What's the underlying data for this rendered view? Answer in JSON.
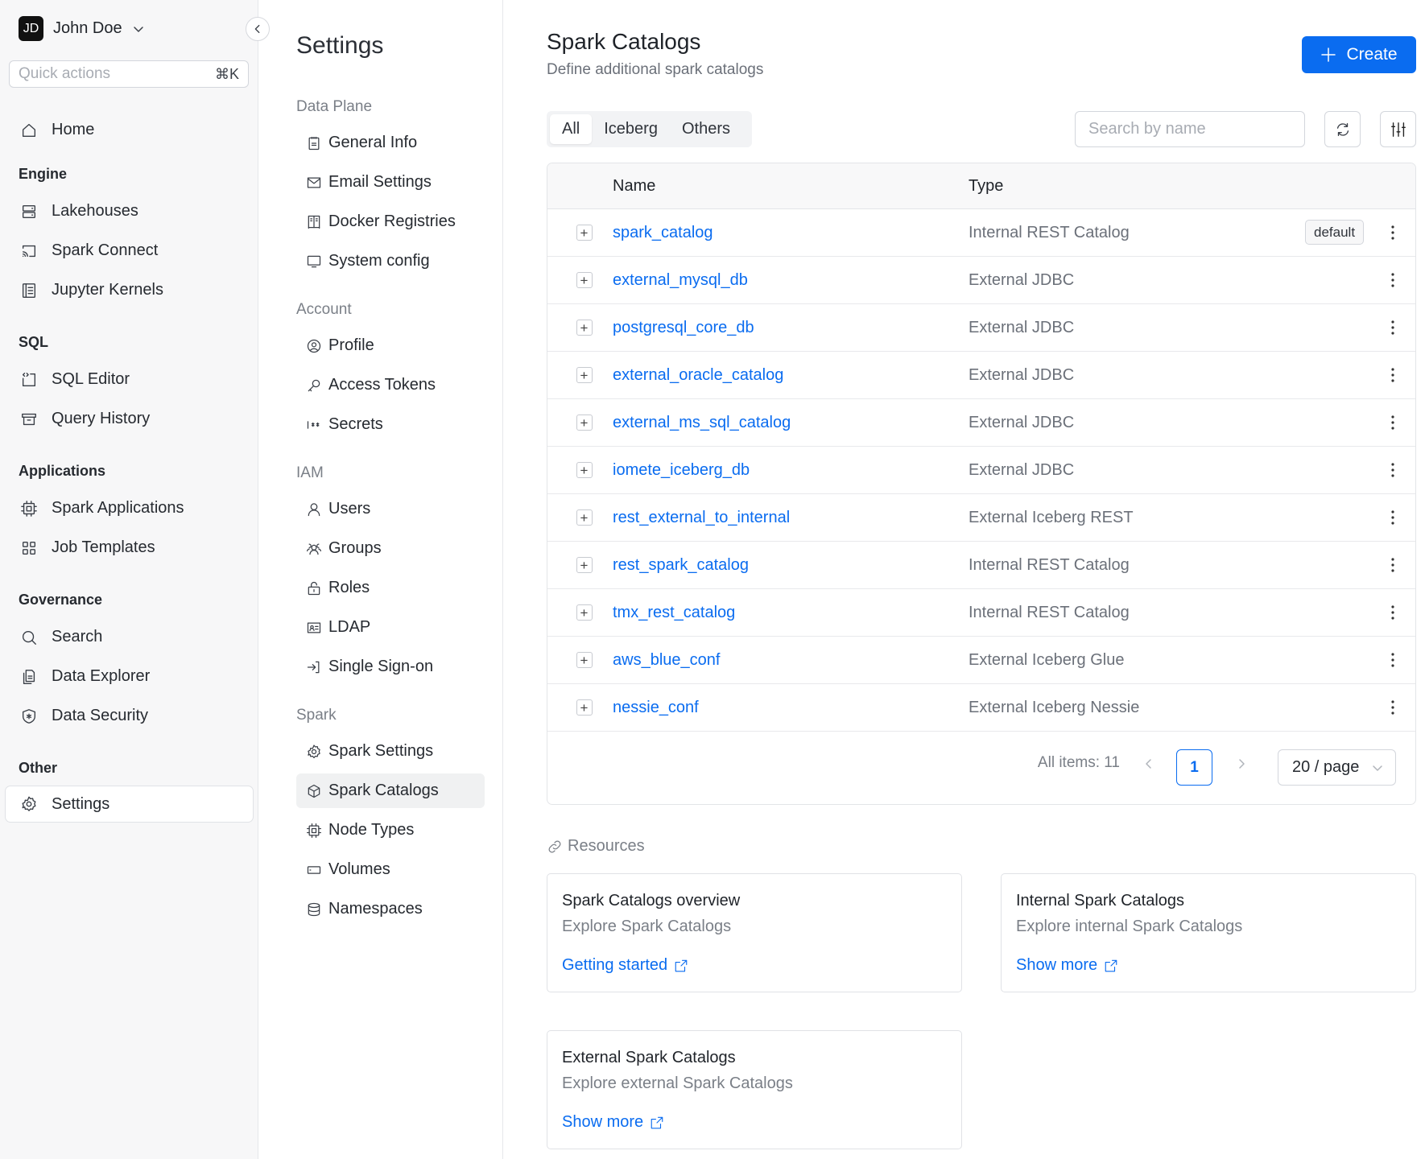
{
  "user": {
    "initials": "JD",
    "name": "John Doe"
  },
  "quick_actions": {
    "placeholder": "Quick actions",
    "shortcut": "⌘K"
  },
  "left_nav": {
    "home": "Home",
    "sections": [
      {
        "title": "Engine",
        "items": [
          "Lakehouses",
          "Spark Connect",
          "Jupyter Kernels"
        ]
      },
      {
        "title": "SQL",
        "items": [
          "SQL Editor",
          "Query History"
        ]
      },
      {
        "title": "Applications",
        "items": [
          "Spark Applications",
          "Job Templates"
        ]
      },
      {
        "title": "Governance",
        "items": [
          "Search",
          "Data Explorer",
          "Data Security"
        ]
      },
      {
        "title": "Other",
        "items": [
          "Settings"
        ]
      }
    ]
  },
  "settings_nav": {
    "title": "Settings",
    "sections": [
      {
        "title": "Data Plane",
        "items": [
          "General Info",
          "Email Settings",
          "Docker Registries",
          "System config"
        ]
      },
      {
        "title": "Account",
        "items": [
          "Profile",
          "Access Tokens",
          "Secrets"
        ]
      },
      {
        "title": "IAM",
        "items": [
          "Users",
          "Groups",
          "Roles",
          "LDAP",
          "Single Sign-on"
        ]
      },
      {
        "title": "Spark",
        "items": [
          "Spark Settings",
          "Spark Catalogs",
          "Node Types",
          "Volumes",
          "Namespaces"
        ]
      }
    ]
  },
  "page": {
    "title": "Spark Catalogs",
    "subtitle": "Define additional spark catalogs",
    "create_label": "Create",
    "tabs": [
      "All",
      "Iceberg",
      "Others"
    ],
    "active_tab": "All",
    "search_placeholder": "Search by name"
  },
  "table": {
    "columns": [
      "Name",
      "Type"
    ],
    "rows": [
      {
        "name": "spark_catalog",
        "type": "Internal REST Catalog",
        "badge": "default"
      },
      {
        "name": "external_mysql_db",
        "type": "External JDBC"
      },
      {
        "name": "postgresql_core_db",
        "type": "External JDBC"
      },
      {
        "name": "external_oracle_catalog",
        "type": "External JDBC"
      },
      {
        "name": "external_ms_sql_catalog",
        "type": "External JDBC"
      },
      {
        "name": "iomete_iceberg_db",
        "type": "External JDBC"
      },
      {
        "name": "rest_external_to_internal",
        "type": "External Iceberg REST"
      },
      {
        "name": "rest_spark_catalog",
        "type": "Internal REST Catalog"
      },
      {
        "name": "tmx_rest_catalog",
        "type": "Internal REST Catalog"
      },
      {
        "name": "aws_blue_conf",
        "type": "External Iceberg Glue"
      },
      {
        "name": "nessie_conf",
        "type": "External Iceberg Nessie"
      }
    ]
  },
  "pagination": {
    "total_label": "All items: 11",
    "current_page": "1",
    "page_size": "20 / page"
  },
  "resources": {
    "title": "Resources",
    "cards": [
      {
        "title": "Spark Catalogs overview",
        "subtitle": "Explore Spark Catalogs",
        "link": "Getting started"
      },
      {
        "title": "Internal Spark Catalogs",
        "subtitle": "Explore internal Spark Catalogs",
        "link": "Show more"
      },
      {
        "title": "External Spark Catalogs",
        "subtitle": "Explore external Spark Catalogs",
        "link": "Show more"
      }
    ]
  },
  "colors": {
    "accent": "#0a6cf0",
    "sidebar_bg": "#f7f7f8"
  }
}
